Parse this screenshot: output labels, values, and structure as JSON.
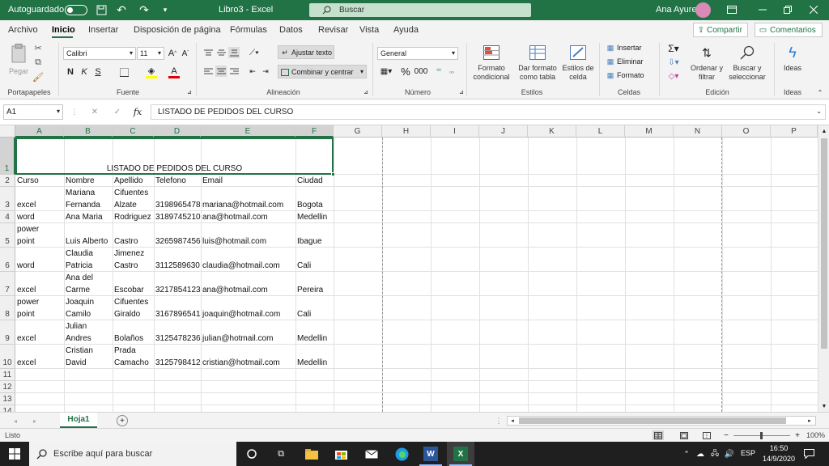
{
  "titlebar": {
    "autosave_label": "Autoguardado",
    "doc_title": "Libro3 - Excel",
    "search_placeholder": "Buscar",
    "user_name": "Ana Ayure"
  },
  "tabs": [
    "Archivo",
    "Inicio",
    "Insertar",
    "Disposición de página",
    "Fórmulas",
    "Datos",
    "Revisar",
    "Vista",
    "Ayuda"
  ],
  "active_tab": "Inicio",
  "share_label": "Compartir",
  "comments_label": "Comentarios",
  "ribbon": {
    "paste": "Pegar",
    "font_name": "Calibri",
    "font_size": "11",
    "wrap_text": "Ajustar texto",
    "merge_center": "Combinar y centrar",
    "number_format": "General",
    "cond_format": "Formato condicional",
    "table_format": "Dar formato como tabla",
    "cell_styles": "Estilos de celda",
    "insert": "Insertar",
    "delete": "Eliminar",
    "format": "Formato",
    "sort_filter": "Ordenar y filtrar",
    "find_select": "Buscar y seleccionar",
    "ideas": "Ideas",
    "groups": {
      "clipboard": "Portapapeles",
      "font": "Fuente",
      "alignment": "Alineación",
      "number": "Número",
      "styles": "Estilos",
      "cells": "Celdas",
      "editing": "Edición",
      "ideas": "Ideas"
    }
  },
  "formula_bar": {
    "name_box": "A1",
    "content": "LISTADO DE PEDIDOS DEL CURSO"
  },
  "columns": [
    "A",
    "B",
    "C",
    "D",
    "E",
    "F",
    "G",
    "H",
    "I",
    "J",
    "K",
    "L",
    "M",
    "N",
    "O",
    "P"
  ],
  "rows": [
    "1",
    "2",
    "3",
    "4",
    "5",
    "6",
    "7",
    "8",
    "9",
    "10",
    "11",
    "12",
    "13",
    "14"
  ],
  "cells": {
    "title": "LISTADO DE PEDIDOS DEL CURSO",
    "headers": [
      "Curso",
      "Nombre",
      "Apellido",
      "Telefono",
      "Email",
      "Ciudad"
    ],
    "data": [
      [
        "excel",
        "Mariana\nFernanda",
        "Cifuentes\nAlzate",
        "3198965478",
        "mariana@hotmail.com",
        "Bogota"
      ],
      [
        "word",
        "Ana Maria",
        "Rodriguez",
        "3189745210",
        "ana@hotmail.com",
        "Medellin"
      ],
      [
        "power\npoint",
        "Luis Alberto",
        "Castro",
        "3265987456",
        "luis@hotmail.com",
        "Ibague"
      ],
      [
        "word",
        "Claudia\nPatricia",
        "Jimenez\nCastro",
        "3112589630",
        "claudia@hotmail.com",
        "Cali"
      ],
      [
        "excel",
        "Ana del\nCarme",
        "Escobar",
        "3217854123",
        "ana@hotmail.com",
        "Pereira"
      ],
      [
        "power\npoint",
        "Joaquin\nCamilo",
        "Cifuentes\nGiraldo",
        "3167896541",
        "joaquin@hotmail.com",
        "Cali"
      ],
      [
        "excel",
        "Julian\nAndres",
        "Bolaños",
        "3125478236",
        "julian@hotmail.com",
        "Medellin"
      ],
      [
        "excel",
        "Cristian\nDavid",
        "Prada\nCamacho",
        "3125798412",
        "cristian@hotmail.com",
        "Medellin"
      ]
    ]
  },
  "sheet_tab": "Hoja1",
  "status": {
    "ready": "Listo",
    "zoom": "100%"
  },
  "taskbar": {
    "search_placeholder": "Escribe aquí para buscar",
    "lang": "ESP",
    "time": "16:50",
    "date": "14/9/2020"
  },
  "colors": {
    "excel_green": "#217346",
    "ribbon_bg": "#f3f3f3",
    "taskbar_bg": "#1f1f1f"
  }
}
